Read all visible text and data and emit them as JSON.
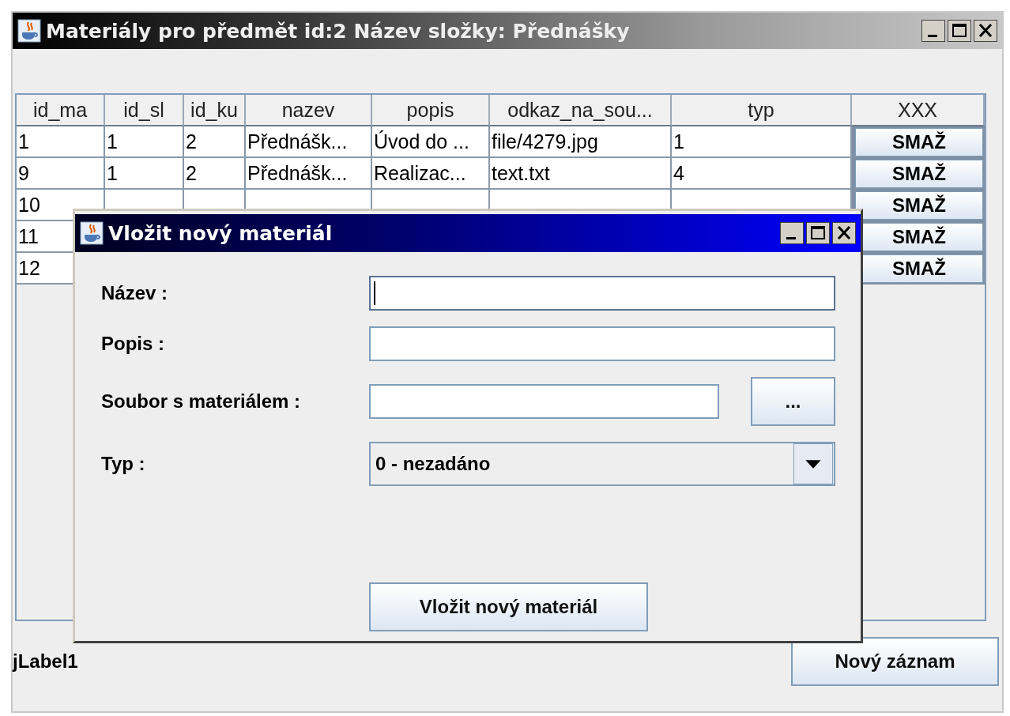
{
  "window": {
    "title": "Materiály pro předmět id:2 Název složky: Přednášky"
  },
  "table": {
    "columns": [
      "id_ma",
      "id_sl",
      "id_ku",
      "nazev",
      "popis",
      "odkaz_na_sou...",
      "typ",
      "XXX"
    ],
    "rows": [
      {
        "cells": [
          "1",
          "1",
          "2",
          "Přednášk...",
          "Úvod do ...",
          "file/4279.jpg",
          "1"
        ],
        "action": "SMAŽ"
      },
      {
        "cells": [
          "9",
          "1",
          "2",
          "Přednášk...",
          "Realizac...",
          "text.txt",
          "4"
        ],
        "action": "SMAŽ"
      },
      {
        "cells": [
          "10"
        ],
        "action": "SMAŽ"
      },
      {
        "cells": [
          "11"
        ],
        "action": "SMAŽ"
      },
      {
        "cells": [
          "12"
        ],
        "action": "SMAŽ"
      }
    ]
  },
  "dialog": {
    "title": "Vložit nový materiál",
    "fields": [
      {
        "kind": "text",
        "label": "Název :",
        "focused": true
      },
      {
        "kind": "text",
        "label": "Popis :",
        "focused": false
      },
      {
        "kind": "file",
        "label": "Soubor s materiálem :",
        "focused": false,
        "button": "..."
      },
      {
        "kind": "select",
        "label": "Typ :",
        "value": "0 - nezadáno"
      }
    ],
    "submit": "Vložit nový materiál"
  },
  "status_label": "jLabel1",
  "new_button": "Nový záznam"
}
